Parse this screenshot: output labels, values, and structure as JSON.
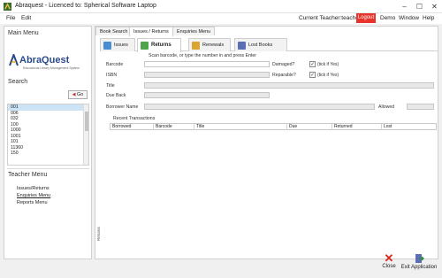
{
  "window": {
    "title": "Abraquest - Licenced to: Spherical Software Laptop",
    "controls": [
      "–",
      "☐",
      "✕"
    ]
  },
  "menubar": {
    "file": "File",
    "edit": "Edit",
    "teacher_label": "Current Teacher:teacher|",
    "logout": "Logout",
    "demo": "Demo",
    "window": "Window",
    "help": "Help"
  },
  "sidebar": {
    "main_menu": "Main Menu",
    "logo_text": "AbraQuest",
    "logo_sub": "Educational Library Management System",
    "search_heading": "Search",
    "go_label": "Go",
    "list_items": [
      "001",
      "006",
      "032",
      "100",
      "1000",
      "1001",
      "101",
      "11360",
      "150"
    ],
    "teacher_menu": "Teacher Menu",
    "teacher_items": [
      "Issues/Returns",
      "Enquiries Menu",
      "Reports Menu"
    ]
  },
  "main": {
    "top_tabs": [
      "Book Search",
      "Issues / Returns",
      "Enquiries Menu"
    ],
    "sub_tabs": [
      "Issues",
      "Returns",
      "Renewals",
      "Lost Books"
    ],
    "hint": "Scan barcode, or type the number in and press Enter",
    "fields": {
      "barcode": "Barcode",
      "isbn": "ISBN",
      "title": "Title",
      "due_back": "Due Back",
      "borrower": "Borrower Name",
      "damaged": "Damaged?",
      "reparable": "Reparable?",
      "tick_if_yes": "(tick if Yes)",
      "allowed": "Allowed"
    },
    "recent_transactions": "Recent Transactions",
    "columns": [
      "Borrowed",
      "Barcode",
      "Title",
      "Due",
      "Returned",
      "Lost"
    ],
    "side_tag": "Returns"
  },
  "bottom": {
    "close": "Close",
    "exit": "Exit Application"
  },
  "colors": {
    "logout_bg": "#e8332a",
    "logo_blue": "#2b4a8b",
    "close_red": "#d9281e",
    "selected_row": "#cde4f7"
  }
}
